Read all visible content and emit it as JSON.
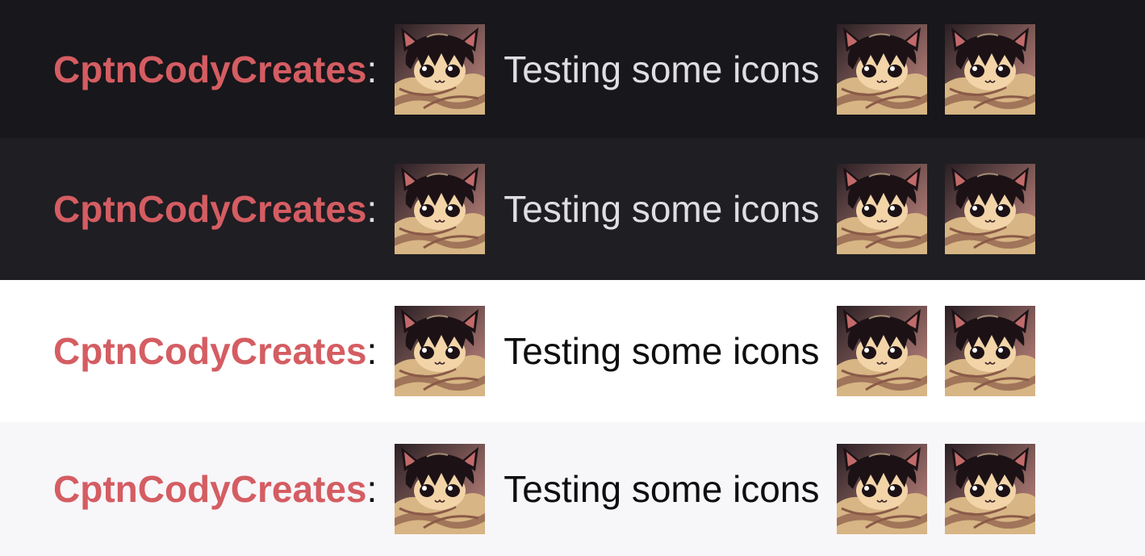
{
  "theme": {
    "username_color": "#d45d62",
    "emote_colors": {
      "background_dark": "#2a1f24",
      "background_light": "#c98d84",
      "hair": "#1c1216",
      "skin": "#f2d4a8",
      "blanket": "#d7b584",
      "blanket_shadow": "#8a5a48",
      "ear_inner": "#c26a6a",
      "eye_white": "#ffffff",
      "mouth": "#3a2228"
    }
  },
  "messages": [
    {
      "background": "#18171b",
      "text_color": "#dedee3",
      "username": "CptnCodyCreates",
      "separator": ":",
      "text": "Testing some icons",
      "emotes_before": [
        "chibi-catboy-icon"
      ],
      "emotes_after": [
        "chibi-catboy-icon",
        "chibi-catboy-icon"
      ]
    },
    {
      "background": "#1f1e23",
      "text_color": "#dedee3",
      "username": "CptnCodyCreates",
      "separator": ":",
      "text": "Testing some icons",
      "emotes_before": [
        "chibi-catboy-icon"
      ],
      "emotes_after": [
        "chibi-catboy-icon",
        "chibi-catboy-icon"
      ]
    },
    {
      "background": "#ffffff",
      "text_color": "#0e0e10",
      "username": "CptnCodyCreates",
      "separator": ":",
      "text": "Testing some icons",
      "emotes_before": [
        "chibi-catboy-icon"
      ],
      "emotes_after": [
        "chibi-catboy-icon",
        "chibi-catboy-icon"
      ]
    },
    {
      "background": "#f7f6f9",
      "text_color": "#0e0e10",
      "username": "CptnCodyCreates",
      "separator": ":",
      "text": "Testing some icons",
      "emotes_before": [
        "chibi-catboy-icon"
      ],
      "emotes_after": [
        "chibi-catboy-icon",
        "chibi-catboy-icon"
      ]
    }
  ]
}
